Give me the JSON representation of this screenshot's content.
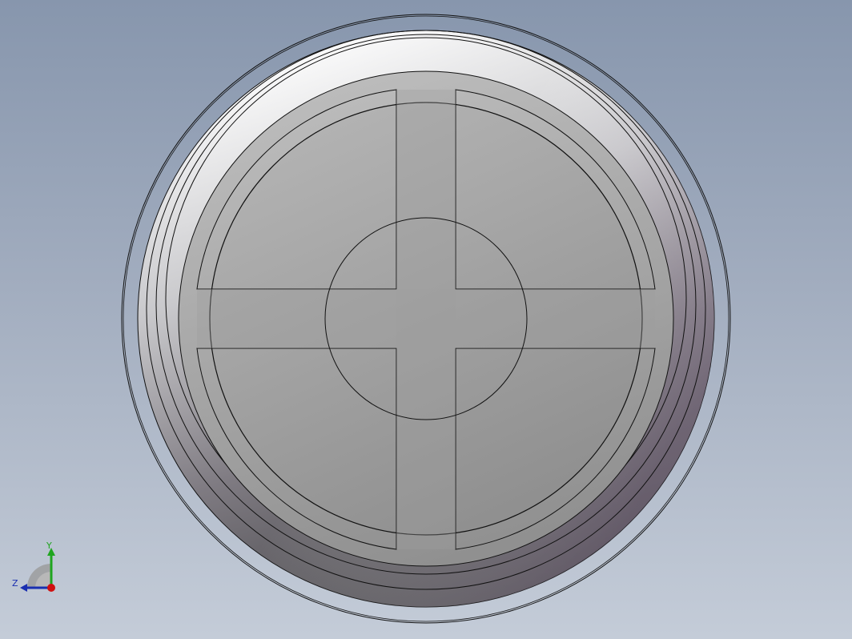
{
  "viewport": {
    "background_top": "#8796ad",
    "background_bottom": "#c4ccd8"
  },
  "part": {
    "description_icon": "circular-cap-with-cross-ribs",
    "edge_color": "#111111"
  },
  "triad": {
    "y_label": "Y",
    "z_label": "Z",
    "y_color": "#1fa51f",
    "z_color": "#1a2fb0",
    "x_color": "#d01010"
  }
}
